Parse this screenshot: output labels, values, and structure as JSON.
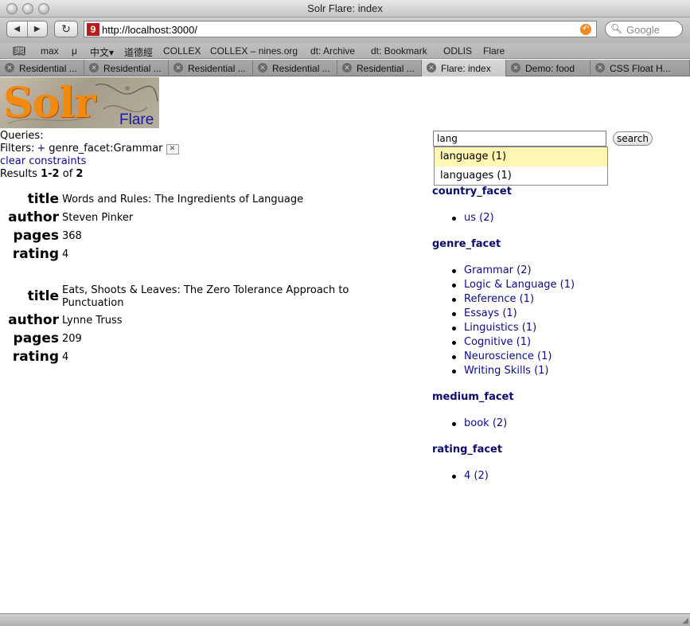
{
  "window": {
    "title": "Solr Flare: index"
  },
  "toolbar": {
    "back_glyph": "◀",
    "forward_glyph": "▶",
    "reload_glyph": "↻",
    "url": "http://localhost:3000/",
    "favicon_text": "9",
    "search_placeholder": "Google"
  },
  "bookmarks": [
    "max",
    "μ",
    "中文▾",
    "道德經",
    "COLLEX",
    "COLLEX – nines.org",
    "dt: Archive",
    "dt: Bookmark",
    "ODLIS",
    "Flare"
  ],
  "tabs": [
    {
      "label": "Residential ...",
      "active": false
    },
    {
      "label": "Residential ...",
      "active": false
    },
    {
      "label": "Residential ...",
      "active": false
    },
    {
      "label": "Residential ...",
      "active": false
    },
    {
      "label": "Residential ...",
      "active": false
    },
    {
      "label": "Flare: index",
      "active": true
    },
    {
      "label": "Demo: food",
      "active": false
    },
    {
      "label": "CSS Float H...",
      "active": false
    }
  ],
  "logo": {
    "main": "Solr",
    "sub": "Flare"
  },
  "constraints": {
    "queries_label": "Queries:",
    "filters_label": "Filters:",
    "filter_op": "+",
    "filter_value": "genre_facet:Grammar",
    "remove_glyph": "✕",
    "clear_label": "clear constraints"
  },
  "results": {
    "prefix": "Results",
    "range": "1-2",
    "of_label": "of",
    "total": "2",
    "docs": [
      {
        "fields": [
          {
            "name": "title",
            "value": "Words and Rules: The Ingredients of Language"
          },
          {
            "name": "author",
            "value": "Steven Pinker"
          },
          {
            "name": "pages",
            "value": "368"
          },
          {
            "name": "rating",
            "value": "4"
          }
        ]
      },
      {
        "fields": [
          {
            "name": "title",
            "value": "Eats, Shoots & Leaves: The Zero Tolerance Approach to Punctuation"
          },
          {
            "name": "author",
            "value": "Lynne Truss"
          },
          {
            "name": "pages",
            "value": "209"
          },
          {
            "name": "rating",
            "value": "4"
          }
        ]
      }
    ]
  },
  "search": {
    "value": "lang",
    "button_label": "search",
    "suggestions": [
      {
        "label": "language (1)",
        "selected": true
      },
      {
        "label": "languages (1)",
        "selected": false
      }
    ]
  },
  "facets": [
    {
      "name": "country_facet",
      "items": [
        "us (2)"
      ]
    },
    {
      "name": "genre_facet",
      "items": [
        "Grammar (2)",
        "Logic & Language (1)",
        "Reference (1)",
        "Essays (1)",
        "Linguistics (1)",
        "Cognitive (1)",
        "Neuroscience (1)",
        "Writing Skills (1)"
      ]
    },
    {
      "name": "medium_facet",
      "items": [
        "book (2)"
      ]
    },
    {
      "name": "rating_facet",
      "items": [
        "4 (2)"
      ]
    }
  ]
}
